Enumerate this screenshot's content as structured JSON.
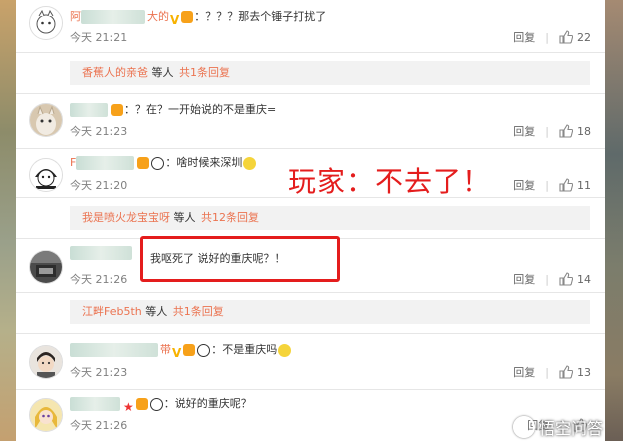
{
  "comments": [
    {
      "name_prefix": "阿",
      "name_suffix": "大的",
      "text": "：？？？那去个锤子打扰了",
      "time": "今天 21:21",
      "reply_label": "回复",
      "likes": "22",
      "badges": [
        "v-badge",
        "level-badge"
      ]
    },
    {
      "name_prefix": "",
      "name_suffix": "",
      "text": "：？在？一开始说的不是重庆=",
      "time": "今天 21:23",
      "reply_label": "回复",
      "likes": "18",
      "badges": [
        "level-badge"
      ]
    },
    {
      "name_prefix": "F",
      "name_suffix": "",
      "text": "：啥时候来深圳",
      "time": "今天 21:20",
      "reply_label": "回复",
      "likes": "11",
      "badges": [
        "level-badge",
        "panda-badge"
      ]
    },
    {
      "name_prefix": "",
      "name_suffix": "",
      "text": "我呕死了 说好的重庆呢？！",
      "time": "今天 21:26",
      "reply_label": "回复",
      "likes": "14",
      "badges": []
    },
    {
      "name_prefix": "",
      "name_suffix": "带",
      "text": "：不是重庆吗",
      "time": "今天 21:23",
      "reply_label": "回复",
      "likes": "13",
      "badges": [
        "v-badge",
        "level-badge",
        "panda-badge"
      ]
    },
    {
      "name_prefix": "",
      "name_suffix": "",
      "text": "：说好的重庆呢？",
      "time": "今天 21:26",
      "reply_label": "回复",
      "likes": "",
      "badges": [
        "star-badge",
        "level-badge",
        "panda-badge"
      ]
    }
  ],
  "reply_bars": [
    {
      "who": "香蕉人的亲爸",
      "etc": "等人",
      "more": "共1条回复"
    },
    {
      "who": "我是喷火龙宝宝呀",
      "etc": "等人",
      "more": "共12条回复"
    },
    {
      "who": "江畔Feb5th",
      "etc": "等人",
      "more": "共1条回复"
    }
  ],
  "annotation": "玩家：不去了！",
  "watermark": "悟空问答",
  "colors": {
    "accent": "#eb7350",
    "annotation_red": "#e41d1d",
    "time_gray": "#808080"
  },
  "icons": [
    "like-thumb-icon",
    "v-badge-icon",
    "level-badge-icon",
    "panda-emoji-icon",
    "smile-emoji-icon",
    "star-badge-icon",
    "wukong-logo-icon"
  ]
}
